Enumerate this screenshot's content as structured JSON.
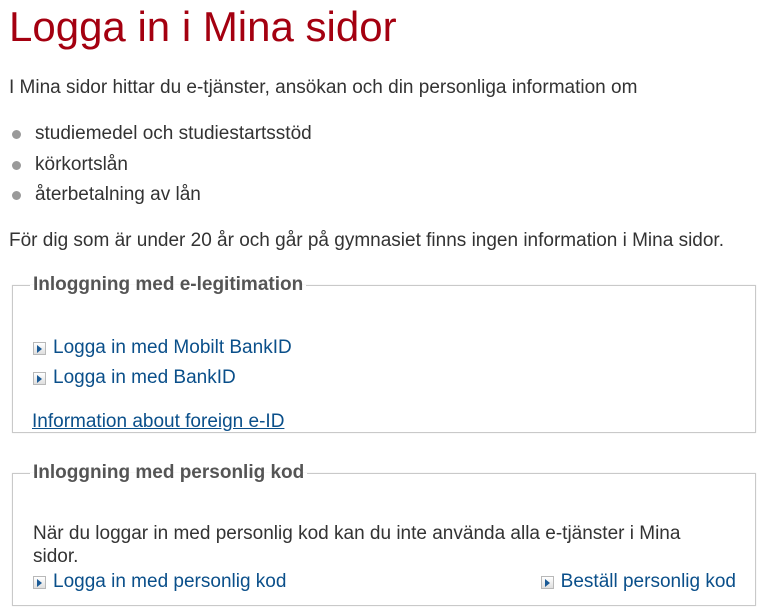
{
  "page": {
    "title": "Logga in i Mina sidor",
    "intro": "I Mina sidor hittar du e-tjänster, ansökan och din personliga information om",
    "bullets": [
      "studiemedel och studiestartsstöd",
      "körkortslån",
      "återbetalning av lån"
    ],
    "age_note": "För dig som är under 20 år och går på gymnasiet finns ingen information i Mina sidor."
  },
  "eleg_section": {
    "legend": "Inloggning med e-legitimation",
    "mobile_bankid_label": "Logga in med Mobilt BankID",
    "bankid_label": "Logga in med BankID",
    "foreign_eid_label": "Information about foreign e-ID"
  },
  "code_section": {
    "legend": "Inloggning med personlig kod",
    "description": "När du loggar in med personlig kod kan du inte använda alla e-tjänster i Mina sidor.",
    "login_label": "Logga in med personlig kod",
    "order_label": "Beställ personlig kod"
  },
  "icons": {
    "link_arrow": "arrow-right-icon",
    "bullet": "bullet-dot-icon"
  },
  "colors": {
    "heading": "#a40010",
    "link": "#0a4f8a",
    "text": "#333333",
    "border": "#c9c9c9"
  }
}
